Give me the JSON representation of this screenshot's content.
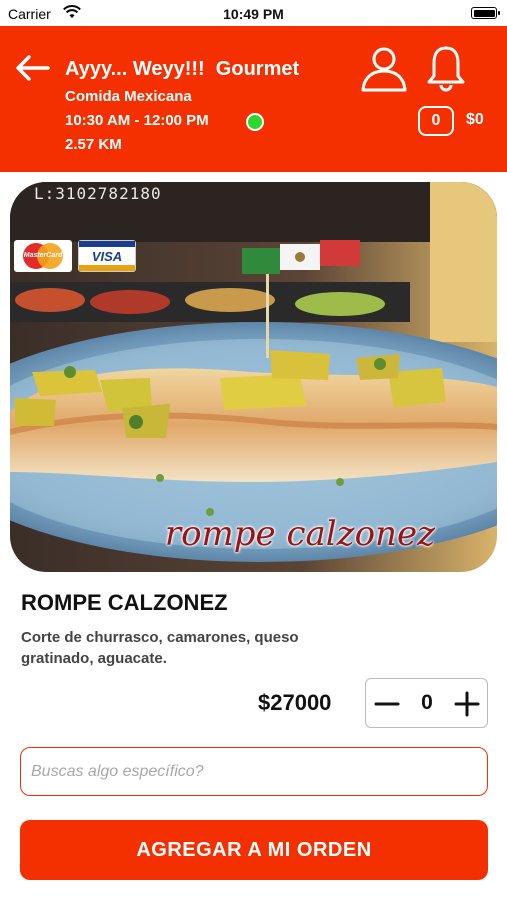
{
  "status_bar": {
    "carrier": "Carrier",
    "time": "10:49 PM"
  },
  "header": {
    "restaurant_name": "Ayyy... Weyy!!!  Gourmet",
    "category": "Comida Mexicana",
    "hours": "10:30 AM - 12:00 PM",
    "open_status_color": "#2fd62f",
    "distance": "2.57 KM",
    "cart_count": "0",
    "cart_total": "$0",
    "background_color": "#f53000",
    "icons": [
      "back-arrow-icon",
      "user-icon",
      "bell-icon"
    ]
  },
  "hero": {
    "phone_text": "L:3102782180",
    "caption": "rompe calzonez",
    "payment_logos": [
      "MasterCard",
      "VISA"
    ]
  },
  "product": {
    "title": "ROMPE CALZONEZ",
    "description": "Corte de churrasco, camarones, queso gratinado, aguacate.",
    "price": "$27000",
    "quantity": "0"
  },
  "search": {
    "placeholder": "Buscas algo específico?",
    "value": ""
  },
  "actions": {
    "add_to_order_label": "AGREGAR A MI ORDEN"
  }
}
